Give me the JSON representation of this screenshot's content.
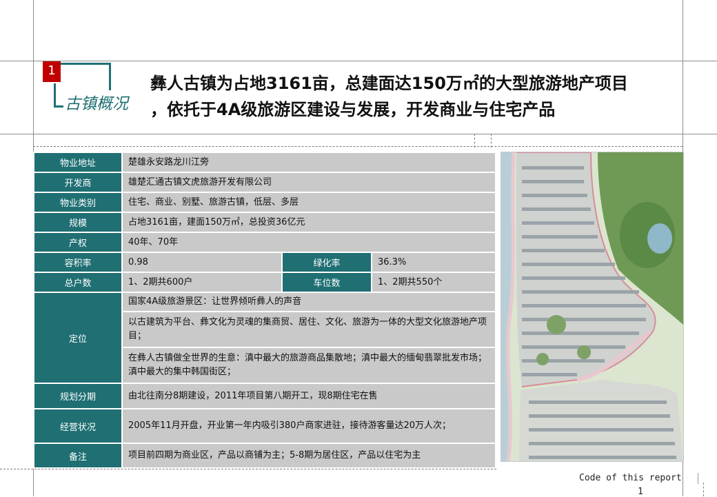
{
  "section": {
    "number": "1",
    "title": "古镇概况"
  },
  "headline": {
    "line1": "彝人古镇为占地3161亩，总建面达150万㎡的大型旅游地产项目",
    "line2": "，依托于4A级旅游区建设与发展，开发商业与住宅产品"
  },
  "table": {
    "address": {
      "label": "物业地址",
      "value": "楚雄永安路龙川江旁"
    },
    "developer": {
      "label": "开发商",
      "value": "雄楚汇通古镇文虎旅游开发有限公司"
    },
    "type": {
      "label": "物业类别",
      "value": "住宅、商业、别墅、旅游古镇，低层、多层"
    },
    "scale": {
      "label": "规模",
      "value": "占地3161亩，建面150万㎡，总投资36亿元"
    },
    "tenure": {
      "label": "产权",
      "value": "40年、70年"
    },
    "far": {
      "label": "容积率",
      "value": "0.98",
      "label2": "绿化率",
      "value2": "36.3%"
    },
    "households": {
      "label": "总户数",
      "value": "1、2期共600户",
      "label2": "车位数",
      "value2": "1、2期共550个"
    },
    "positioning": {
      "label": "定位",
      "value1": "国家4A级旅游景区：让世界倾听彝人的声音",
      "value2": "以古建筑为平台、彝文化为灵魂的集商贸、居住、文化、旅游为一体的大型文化旅游地产项目；",
      "value3": "在彝人古镇做全世界的生意：滇中最大的旅游商品集散地；滇中最大的缅甸翡翠批发市场；滇中最大的集中韩国街区；"
    },
    "phases": {
      "label": "规划分期",
      "value": "由北往南分8期建设，2011年项目第八期开工，现8期住宅在售"
    },
    "operation": {
      "label": "经营状况",
      "value": "2005年11月开盘，开业第一年内吸引380户商家进驻，接待游客量达20万人次；"
    },
    "remarks": {
      "label": "备注",
      "value": "项目前四期为商业区，产品以商铺为主；5-8期为居住区，产品以住宅为主"
    }
  },
  "footer": {
    "text": "Code of this report",
    "page": "1"
  }
}
